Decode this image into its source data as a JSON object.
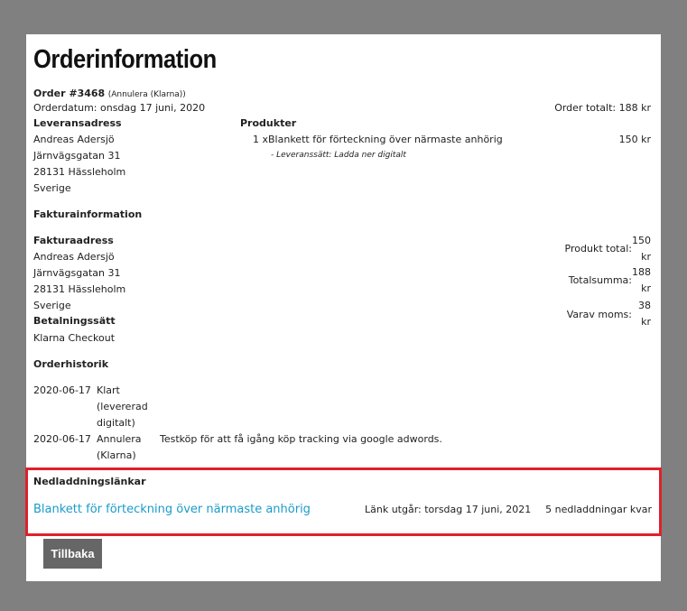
{
  "title": "Orderinformation",
  "order": {
    "number_label": "Order #3468",
    "status_note": "(Annulera (Klarna))",
    "date": "Orderdatum: onsdag 17 juni, 2020",
    "total": "Order totalt: 188 kr"
  },
  "delivery": {
    "heading": "Leveransadress",
    "lines": [
      "Andreas Adersjö",
      "Järnvägsgatan 31",
      "28131 Hässleholm",
      "Sverige"
    ]
  },
  "products": {
    "heading": "Produkter",
    "items": [
      {
        "qty": "1 x",
        "name": "Blankett för förteckning över närmaste anhörig",
        "price": "150 kr",
        "note": "- Leveranssätt: Ladda ner digitalt"
      }
    ]
  },
  "invoice": {
    "heading": "Fakturainformation",
    "address_heading": "Fakturaadress",
    "lines": [
      "Andreas Adersjö",
      "Järnvägsgatan 31",
      "28131 Hässleholm",
      "Sverige"
    ],
    "payment_heading": "Betalningssätt",
    "payment_method": "Klarna Checkout"
  },
  "summary": {
    "product_total_label": "Produkt total:",
    "product_total_value": [
      "150",
      "kr"
    ],
    "sum_label": "Totalsumma:",
    "sum_value": [
      "188",
      "kr"
    ],
    "vat_label": "Varav moms:",
    "vat_value": [
      "38",
      "kr"
    ]
  },
  "history": {
    "heading": "Orderhistorik",
    "rows": [
      {
        "date": "2020-06-17",
        "status": [
          "Klart",
          "(levererad",
          "digitalt)"
        ],
        "comment": ""
      },
      {
        "date": "2020-06-17",
        "status": [
          "Annulera",
          "(Klarna)"
        ],
        "comment": "Testköp för att få igång köp tracking via google adwords."
      }
    ]
  },
  "downloads": {
    "heading": "Nedladdningslänkar",
    "link_text": "Blankett för förteckning över närmaste anhörig",
    "expires": "Länk utgår: torsdag 17 juni, 2021",
    "remaining": "5 nedladdningar kvar"
  },
  "back_label": "Tillbaka",
  "colors": {
    "link": "#1b9bc9",
    "highlight_border": "#e0202a",
    "button_bg": "#666666",
    "backdrop": "#808080"
  }
}
